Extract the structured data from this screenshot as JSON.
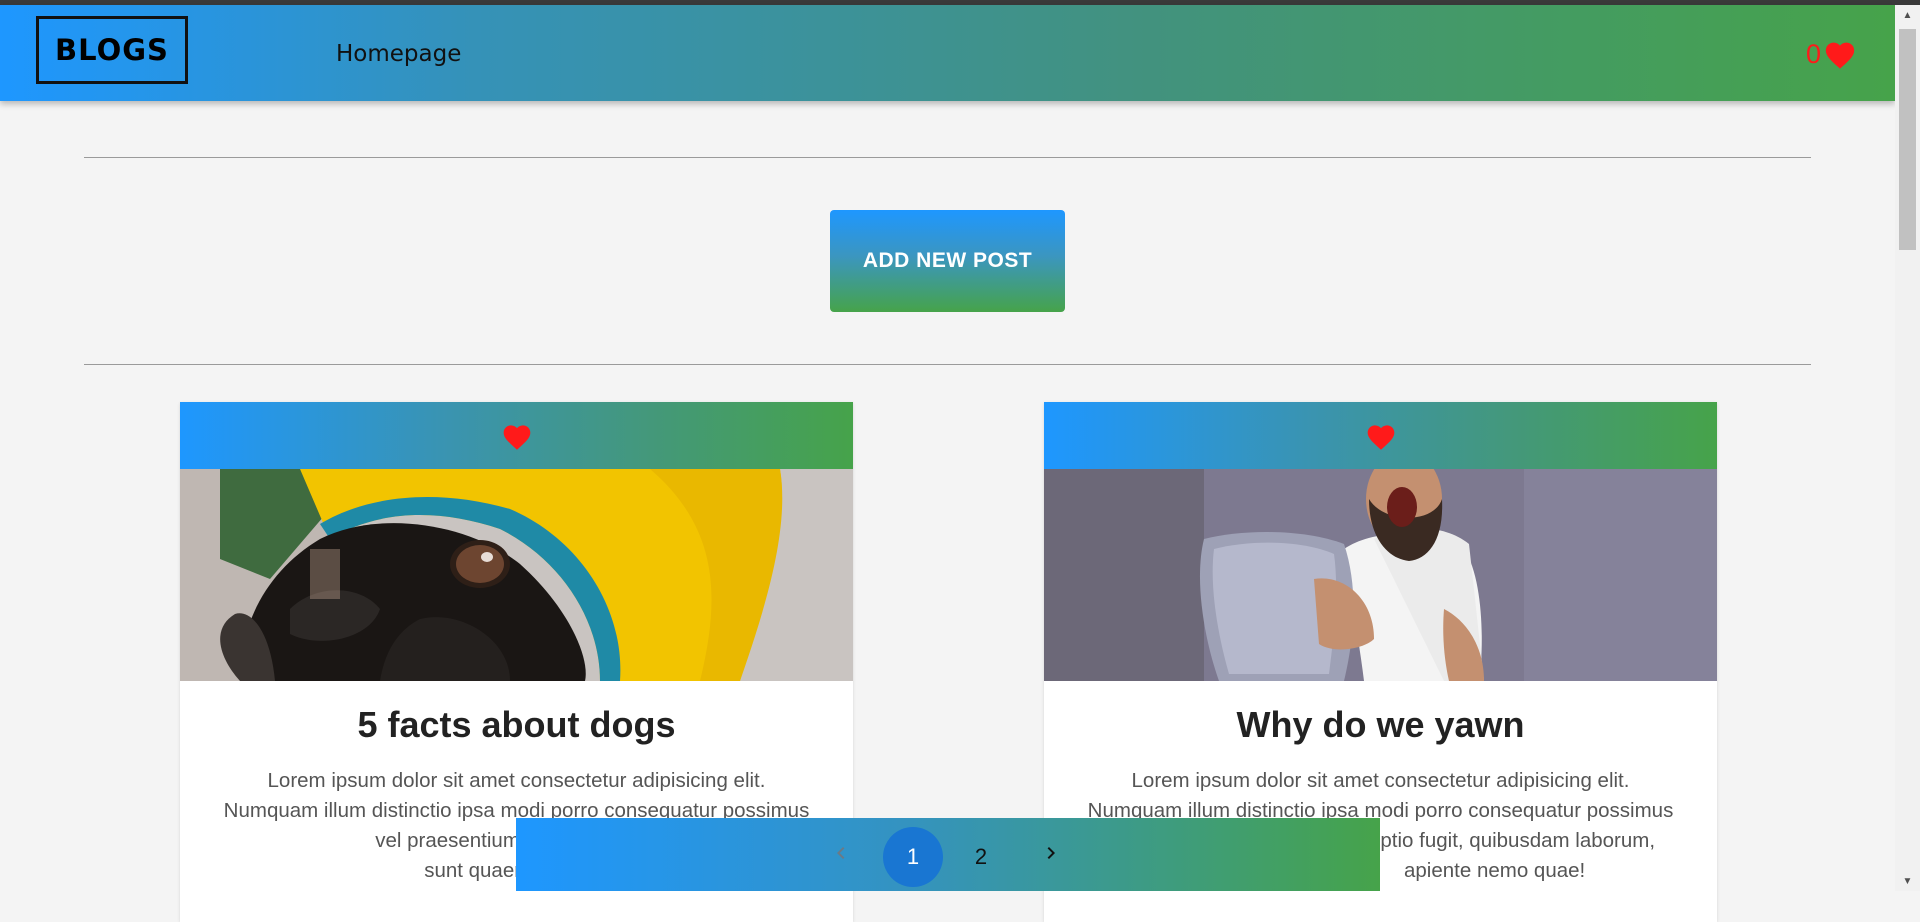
{
  "header": {
    "logo": "BLOGS",
    "nav_link": "Homepage",
    "favorites_count": "0",
    "heart_icon": "heart-icon"
  },
  "actions": {
    "add_post_label": "ADD NEW POST"
  },
  "posts": [
    {
      "title": "5 facts about dogs",
      "excerpt_lines": [
        "Lorem ipsum dolor sit amet consectetur adipisicing elit.",
        "Numquam illum distinctio ipsa modi porro consequatur possimus",
        "vel praesentium nulla placeat o",
        "sunt quaerat ullam s"
      ],
      "image_desc": "pug-in-yellow-raincoat"
    },
    {
      "title": "Why do we yawn",
      "excerpt_lines": [
        "Lorem ipsum dolor sit amet consectetur adipisicing elit.",
        "Numquam illum distinctio ipsa modi porro consequatur possimus",
        "optio fugit, quibusdam laborum,",
        "apiente nemo quae!"
      ],
      "image_desc": "man-yawning-holding-pillow"
    }
  ],
  "pagination": {
    "pages": [
      "1",
      "2"
    ],
    "current": "1",
    "prev_icon": "chevron-left-icon",
    "next_icon": "chevron-right-icon"
  },
  "colors": {
    "gradient_start": "#1e97ff",
    "gradient_end": "#46a34a",
    "heart": "#ff1a1a",
    "active_page": "#1976d2"
  }
}
